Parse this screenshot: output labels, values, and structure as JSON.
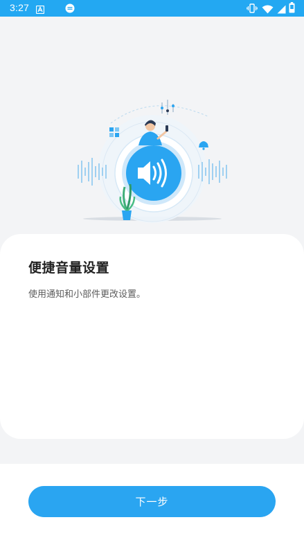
{
  "status_bar": {
    "time": "3:27",
    "icons": [
      "notification-a-icon",
      "message-icon",
      "vibrate-icon",
      "wifi-icon",
      "signal-icon",
      "battery-icon"
    ]
  },
  "hero": {
    "icon": "speaker-volume-icon",
    "colors": {
      "primary": "#2aa5f1",
      "background": "#e8f3fb"
    }
  },
  "card": {
    "title": "便捷音量设置",
    "description": "使用通知和小部件更改设置。"
  },
  "footer": {
    "next_label": "下一步"
  },
  "colors": {
    "accent": "#2aa5f1",
    "status_bar": "#23a8f2",
    "page_background": "#f3f4f6"
  }
}
